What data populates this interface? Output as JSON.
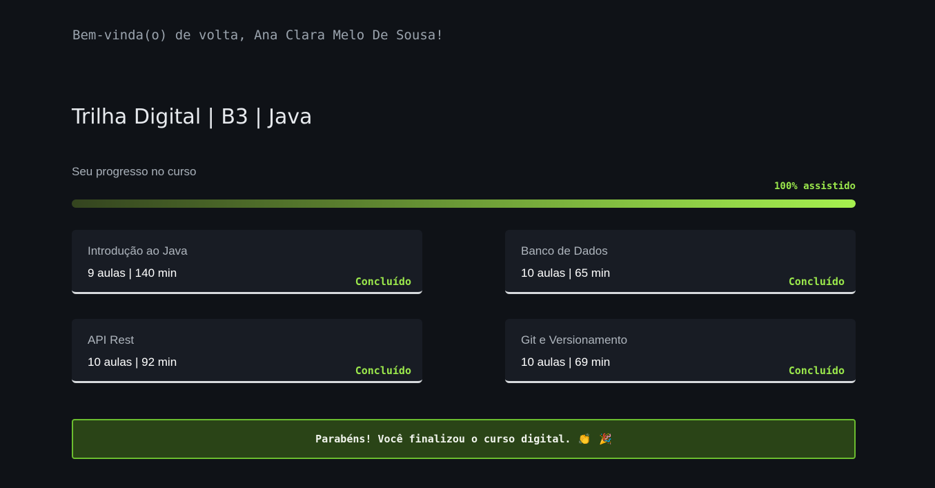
{
  "header": {
    "welcome": "Bem-vinda(o) de volta, Ana Clara Melo De Sousa!"
  },
  "course": {
    "title": "Trilha Digital | B3 | Java"
  },
  "progress": {
    "label": "Seu progresso no curso",
    "percent_label": "100% assistido",
    "value": 1.0
  },
  "modules": [
    {
      "name": "Introdução ao Java",
      "meta": "9 aulas | 140 min",
      "status": "Concluído"
    },
    {
      "name": "Banco de Dados",
      "meta": "10 aulas | 65 min",
      "status": "Concluído"
    },
    {
      "name": "API Rest",
      "meta": "10 aulas | 92 min",
      "status": "Concluído"
    },
    {
      "name": "Git e Versionamento",
      "meta": "10 aulas | 69 min",
      "status": "Concluído"
    }
  ],
  "congrats": {
    "message": "Parabéns! Você finalizou o curso digital.",
    "emoji_1": "👏",
    "emoji_2": "🎉"
  },
  "colors": {
    "background": "#0f1217",
    "accent": "#9be84c",
    "card": "#181c24",
    "congrats_bg": "#2a4417",
    "congrats_border": "#6bbd2f"
  }
}
